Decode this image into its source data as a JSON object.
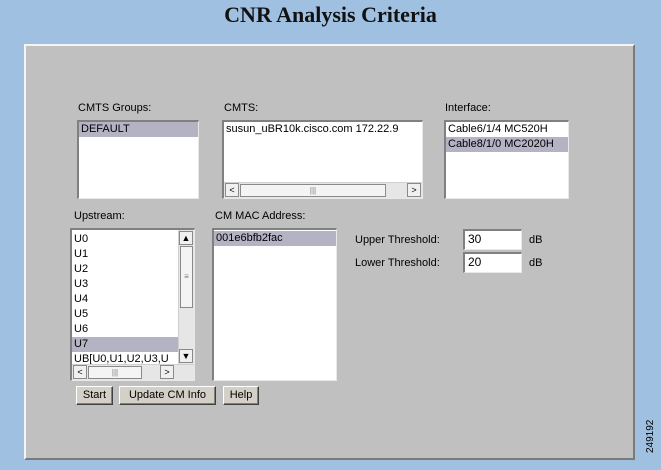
{
  "page_title": "CNR Analysis Criteria",
  "cmts_groups": {
    "label": "CMTS Groups:",
    "items": [
      "DEFAULT"
    ]
  },
  "cmts": {
    "label": "CMTS:",
    "items": [
      "susun_uBR10k.cisco.com 172.22.9"
    ]
  },
  "interface": {
    "label": "Interface:",
    "items": [
      "Cable6/1/4 MC520H",
      "Cable8/1/0 MC2020H"
    ]
  },
  "upstream": {
    "label": "Upstream:",
    "items": [
      "U0",
      "U1",
      "U2",
      "U3",
      "U4",
      "U5",
      "U6",
      "U7",
      "UB[U0,U1,U2,U3,U"
    ]
  },
  "cm_mac": {
    "label": "CM MAC Address:",
    "items": [
      "001e6bfb2fac"
    ]
  },
  "thresholds": {
    "upper_label": "Upper Threshold:",
    "upper_value": "30",
    "upper_unit": "dB",
    "lower_label": "Lower Threshold:",
    "lower_value": "20",
    "lower_unit": "dB"
  },
  "buttons": {
    "start": "Start",
    "update": "Update CM Info",
    "help": "Help"
  },
  "scroll_glyphs": {
    "left": "<",
    "right": ">",
    "up": "▲",
    "down": "▼",
    "grip": "|||",
    "vgrip": "≡"
  },
  "figure_id": "249192"
}
